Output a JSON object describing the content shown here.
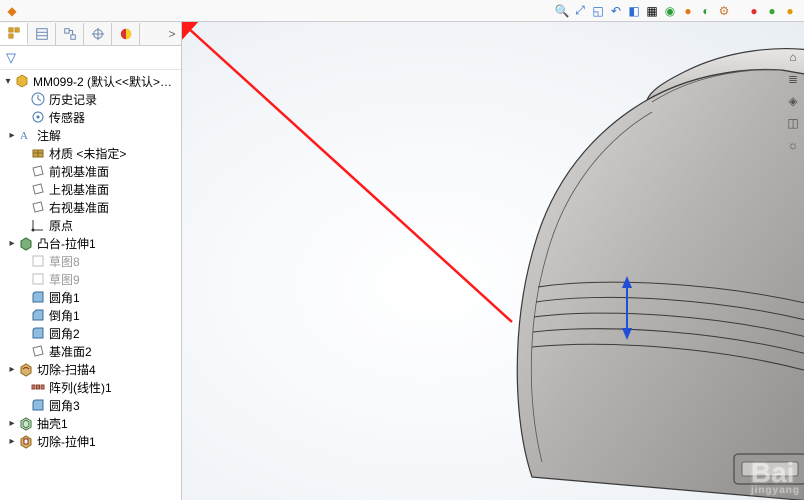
{
  "document": {
    "title": "MM099-2 (默认<<默认>_显",
    "part_name": "MM099-2"
  },
  "tabs": {
    "feature_manager": "FeatureManager",
    "property_manager": "PropertyManager",
    "configuration_manager": "ConfigurationManager",
    "dimxpert_manager": "DimXpertManager",
    "display_manager": "DisplayManager",
    "expand": ">"
  },
  "tree": [
    {
      "id": "history",
      "label": "历史记录",
      "icon": "history",
      "depth": 1,
      "caret": false,
      "disabled": false
    },
    {
      "id": "sensors",
      "label": "传感器",
      "icon": "sensor",
      "depth": 1,
      "caret": false,
      "disabled": false
    },
    {
      "id": "annot",
      "label": "注解",
      "icon": "annot",
      "depth": 1,
      "caret": true,
      "disabled": false
    },
    {
      "id": "material",
      "label": "材质 <未指定>",
      "icon": "material",
      "depth": 1,
      "caret": false,
      "disabled": false
    },
    {
      "id": "plane_f",
      "label": "前视基准面",
      "icon": "plane",
      "depth": 1,
      "caret": false,
      "disabled": false
    },
    {
      "id": "plane_t",
      "label": "上视基准面",
      "icon": "plane",
      "depth": 1,
      "caret": false,
      "disabled": false
    },
    {
      "id": "plane_r",
      "label": "右视基准面",
      "icon": "plane",
      "depth": 1,
      "caret": false,
      "disabled": false
    },
    {
      "id": "origin",
      "label": "原点",
      "icon": "origin",
      "depth": 1,
      "caret": false,
      "disabled": false
    },
    {
      "id": "boss1",
      "label": "凸台-拉伸1",
      "icon": "extrude",
      "depth": 1,
      "caret": true,
      "disabled": false
    },
    {
      "id": "sketch8",
      "label": "草图8",
      "icon": "sketch",
      "depth": 1,
      "caret": false,
      "disabled": true
    },
    {
      "id": "sketch9",
      "label": "草图9",
      "icon": "sketch",
      "depth": 1,
      "caret": false,
      "disabled": true
    },
    {
      "id": "fillet1",
      "label": "圆角1",
      "icon": "fillet",
      "depth": 1,
      "caret": false,
      "disabled": false
    },
    {
      "id": "chamfer1",
      "label": "倒角1",
      "icon": "chamfer",
      "depth": 1,
      "caret": false,
      "disabled": false
    },
    {
      "id": "fillet2",
      "label": "圆角2",
      "icon": "fillet",
      "depth": 1,
      "caret": false,
      "disabled": false
    },
    {
      "id": "plane2",
      "label": "基准面2",
      "icon": "plane",
      "depth": 1,
      "caret": false,
      "disabled": false
    },
    {
      "id": "cutsweep4",
      "label": "切除-扫描4",
      "icon": "cutsweep",
      "depth": 1,
      "caret": true,
      "disabled": false
    },
    {
      "id": "lpattern1",
      "label": "阵列(线性)1",
      "icon": "lpattern",
      "depth": 1,
      "caret": false,
      "disabled": false
    },
    {
      "id": "fillet3",
      "label": "圆角3",
      "icon": "fillet",
      "depth": 1,
      "caret": false,
      "disabled": false
    },
    {
      "id": "shell1",
      "label": "抽壳1",
      "icon": "shell",
      "depth": 1,
      "caret": true,
      "disabled": false
    },
    {
      "id": "cutext1",
      "label": "切除-拉伸1",
      "icon": "cutext",
      "depth": 1,
      "caret": true,
      "disabled": false
    }
  ],
  "toolbar_right": {
    "items": [
      "search",
      "zoom-fit",
      "zoom-area",
      "prev-view",
      "section",
      "display-style",
      "hide-show",
      "edit-appearance",
      "apply-scene",
      "view-settings",
      "ball1",
      "ball2",
      "ball3"
    ]
  },
  "gutter": {
    "items": [
      "home",
      "layers",
      "appearance",
      "decal",
      "scene"
    ]
  },
  "triad": {
    "label": "↕"
  },
  "watermark": {
    "main": "Bai",
    "sub": "jingyang"
  }
}
